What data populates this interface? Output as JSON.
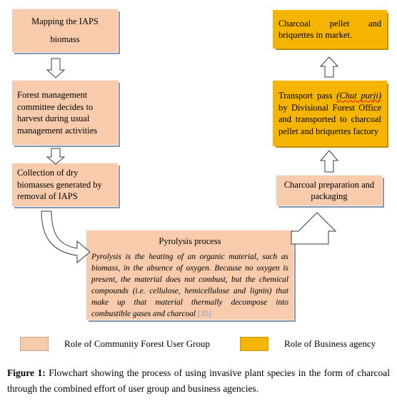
{
  "figure": {
    "boxes": {
      "mapping": "Mapping the IAPS biomass",
      "committee": "Forest management committee decides to harvest during usual management activities",
      "collection": "Collection of dry biomasses generated by removal of IAPS",
      "pyrolysis_title": "Pyrolysis process",
      "pyrolysis_body_before": "Pyrolysis is the heating of an organic material, such as biomass, in the absence of oxygen. Because no oxygen is present, the material does not combust, but the chemical compounds (i.e. cellulose, hemicellulose and lignin) that make up that material thermally decompose into combustible gases and charcoal ",
      "pyrolysis_citation": "[35]",
      "charcoal_prep": "Charcoal preparation and packaging",
      "transport_before": "Transport pass ",
      "transport_term": "(Chut purji)",
      "transport_after": " by Divisional Forest Office and transported to charcoal pellet and briquettes factory",
      "market": "Charcoal pellet and briquettes in market."
    },
    "colors": {
      "community_group_fill": "#f7cbac",
      "business_agency_fill": "#f5b400",
      "box_shadow": "#8496b0",
      "citation": "#8aa0c8",
      "arrow_stroke": "#3b3b3b",
      "spellcheck_underline": "#e03030"
    },
    "arrows": [
      {
        "name": "mapping-to-committee",
        "direction": "down"
      },
      {
        "name": "committee-to-collection",
        "direction": "down"
      },
      {
        "name": "collection-to-pyrolysis",
        "direction": "curved-down-right"
      },
      {
        "name": "pyrolysis-to-charcoal-prep",
        "direction": "elbow-left-up"
      },
      {
        "name": "charcoal-prep-to-transport",
        "direction": "up"
      },
      {
        "name": "transport-to-market",
        "direction": "up"
      }
    ]
  },
  "legend": {
    "items": [
      {
        "swatch_color": "#f7cbac",
        "label": "Role of Community Forest User Group"
      },
      {
        "swatch_color": "#f5b400",
        "label": "Role of Business agency"
      }
    ]
  },
  "caption": {
    "label": "Figure 1:",
    "text": " Flowchart showing the process of using invasive plant species in the form of charcoal through the combined effort of user group and business agencies."
  }
}
